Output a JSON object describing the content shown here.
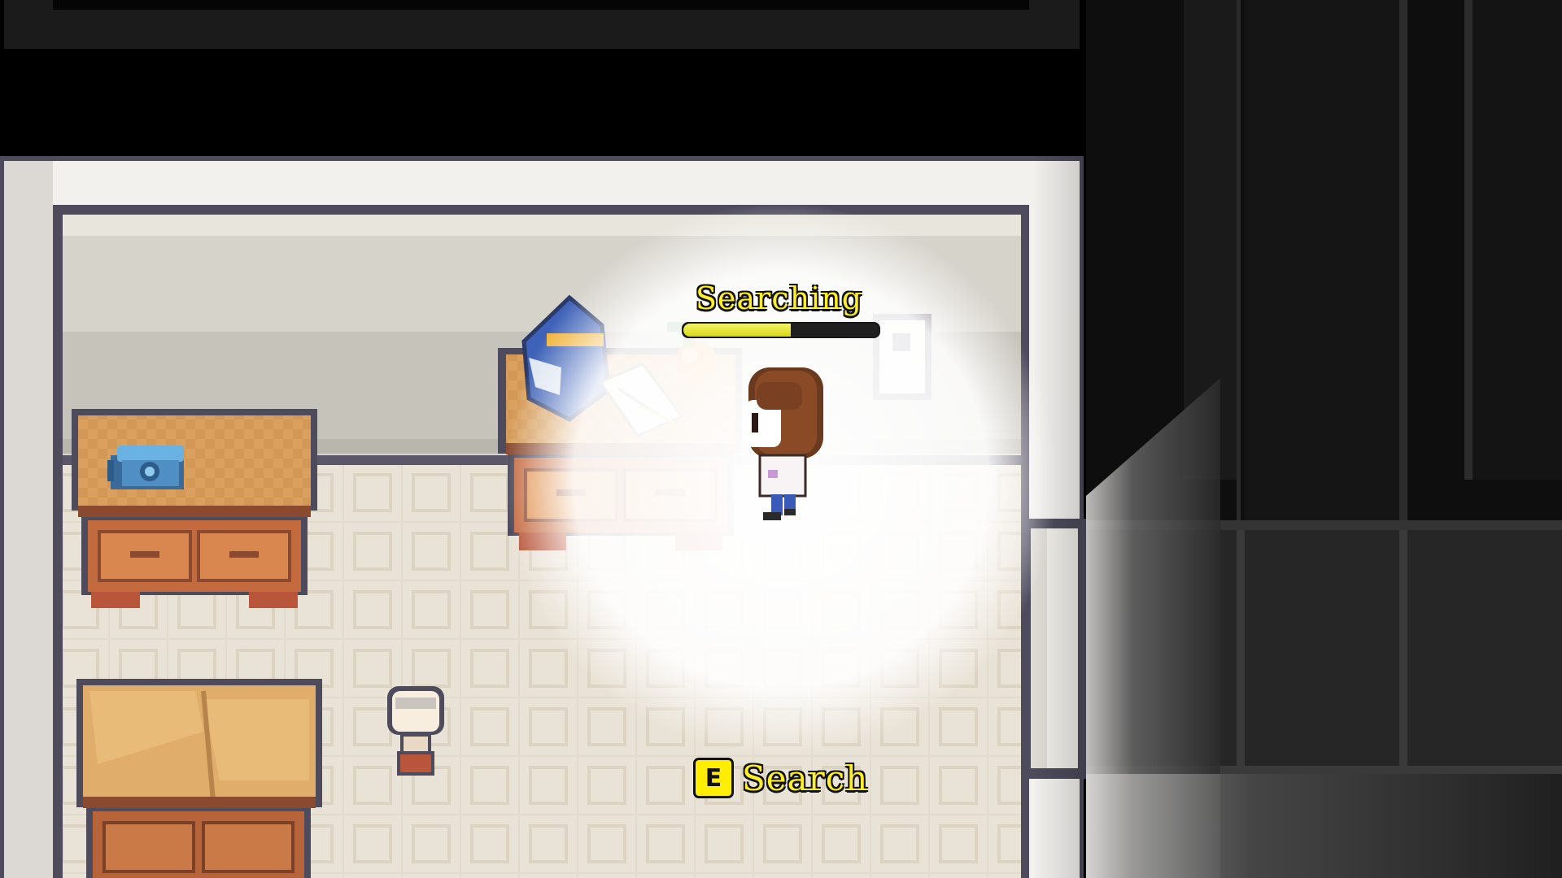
{
  "hud": {
    "status_label": "Searching",
    "progress": 0.55,
    "interaction_key": "E",
    "interaction_label": "Search"
  },
  "colors": {
    "accent_yellow": "#ffef2a",
    "key_badge": "#ffee00",
    "progress_fill": "#e6e62a"
  },
  "icons": [
    "telephone-icon",
    "table-lamp-icon",
    "light-switch-icon"
  ]
}
